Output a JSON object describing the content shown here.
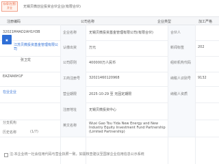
{
  "header": {
    "org_tag": "存续(在营)\n开业",
    "title": "无锡贝微创业投资合伙企业(有限合伙)"
  },
  "tabs": [
    "注册编码",
    "公司名称",
    "",
    "企业类型",
    "",
    "加工严格"
  ],
  "left_col": {
    "reg_no": "32021M4AD2AH1H3B",
    "company_link": "江苏贝微投资基金管理有限公司",
    "person": "张卫龙",
    "code2": "EAZ4A6H1F",
    "status_tag": "在业企业",
    "admin_label": "分支机构",
    "history_label": "历史名称",
    "count_label": "(1/7)"
  },
  "mid_col": {
    "labels": [
      "企业名称",
      "认缴出资",
      "公司原则",
      "工商注册号",
      "营业期限",
      "注册地址",
      "英文名称"
    ],
    "values": [
      "无锡贝微投资基金管理有限公司(有限合伙)",
      "万元",
      "400000万人民币",
      "32021460120968",
      "2025-10-29 至 无固定期限",
      "无锡贝微投资中心",
      "Wuxi Gao Tou Yida New Energy and New Industry Equity Investment Fund Partnership (Limited Partnership)"
    ],
    "extra": "无锡高投"
  },
  "right_col": {
    "labels": [
      "合伙人",
      "新闻标签",
      "组织机构代码",
      "纳税人识别号",
      "纳税人资质",
      "",
      ""
    ],
    "values": [
      "",
      "202",
      "",
      "9132",
      "",
      "",
      ""
    ]
  },
  "footer": {
    "note": "注:本企业统一社会信用代码与营业执照一致，如需核查建议至国家企业信用信息公示系统"
  }
}
